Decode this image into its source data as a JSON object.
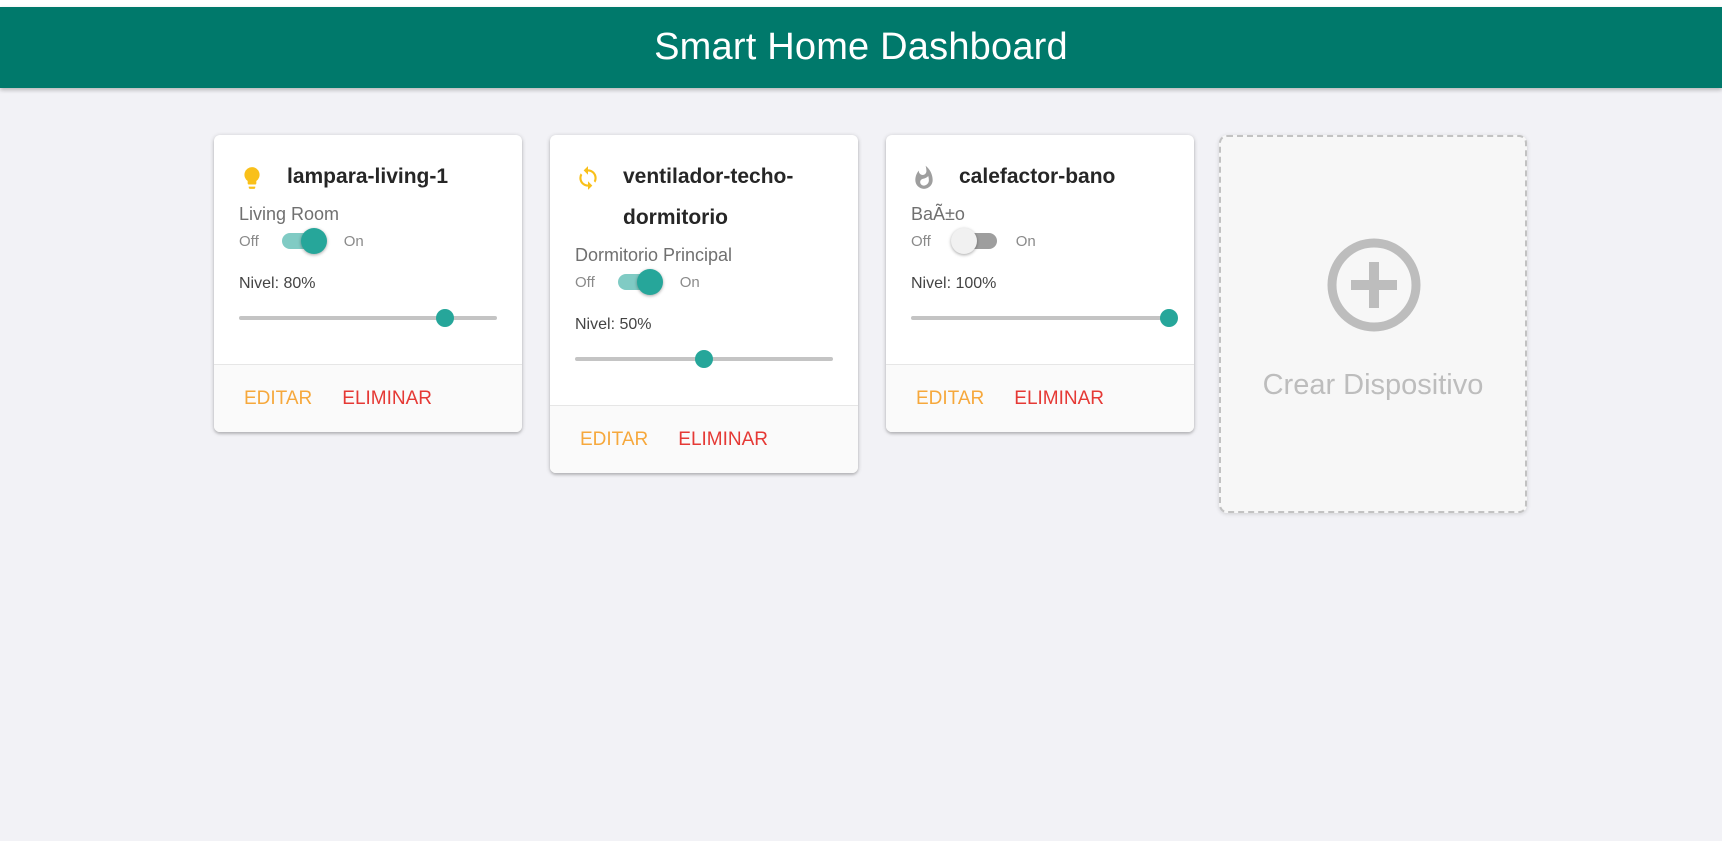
{
  "header": {
    "title": "Smart Home Dashboard"
  },
  "colors": {
    "header_bg": "#00796b",
    "accent": "#26a69a",
    "edit": "#f6a83c",
    "delete": "#e53935",
    "bulb_icon": "#f9c01a",
    "fan_icon": "#f9c01a",
    "heater_icon": "#9e9e9e"
  },
  "devices": [
    {
      "name": "lampara-living-1",
      "icon": "lightbulb-icon",
      "room": "Living Room",
      "off_label": "Off",
      "on_label": "On",
      "is_on": true,
      "level_text": "Nivel: 80%",
      "level": 80,
      "edit_label": "Editar",
      "delete_label": "Eliminar"
    },
    {
      "name": "ventilador-techo-dormitorio",
      "icon": "sync-icon",
      "room": "Dormitorio Principal",
      "off_label": "Off",
      "on_label": "On",
      "is_on": true,
      "level_text": "Nivel: 50%",
      "level": 50,
      "edit_label": "Editar",
      "delete_label": "Eliminar"
    },
    {
      "name": "calefactor-bano",
      "icon": "flame-icon",
      "room": "BaÃ±o",
      "off_label": "Off",
      "on_label": "On",
      "is_on": false,
      "level_text": "Nivel: 100%",
      "level": 100,
      "edit_label": "Editar",
      "delete_label": "Eliminar"
    }
  ],
  "add_card": {
    "label": "Crear Dispositivo",
    "icon": "add-circle-icon"
  }
}
